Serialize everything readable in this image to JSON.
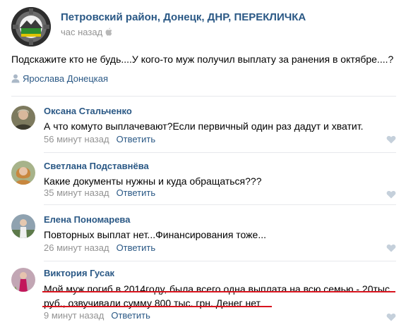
{
  "post": {
    "group_name": "Петровский район, Донецк, ДНР, ПЕРЕКЛИЧКА",
    "time": "час назад",
    "text": "Подскажите кто не будь....У кого-то муж получил выплату за ранения в октябре....?",
    "author": "Ярослава Донецкая",
    "icons": [
      "apple-icon",
      "user-icon"
    ]
  },
  "comments": [
    {
      "name": "Оксана Стальченко",
      "text": "А что комуто выплачевают?Если первичный один раз дадут и хватит.",
      "time": "56 минут назад",
      "reply": "Ответить"
    },
    {
      "name": "Светлана Подставнёва",
      "text": "Какие документы нужны и куда обращаться???",
      "time": "35 минут назад",
      "reply": "Ответить"
    },
    {
      "name": "Елена Пономарева",
      "text": "Повторных выплат нет...Финансирования тоже...",
      "time": "26 минут назад",
      "reply": "Ответить"
    },
    {
      "name": "Виктория Гусак",
      "text_line1": "Мой муж погиб в 2014году, была всего одна выплата на всю семью - 20тыс.",
      "text_line2": "руб., озвучивали сумму 800 тыс. грн. Денег нет",
      "time": "9 минут назад",
      "reply": "Ответить"
    }
  ],
  "colors": {
    "link": "#2a5885",
    "meta": "#939393",
    "underline": "#d8141e"
  }
}
